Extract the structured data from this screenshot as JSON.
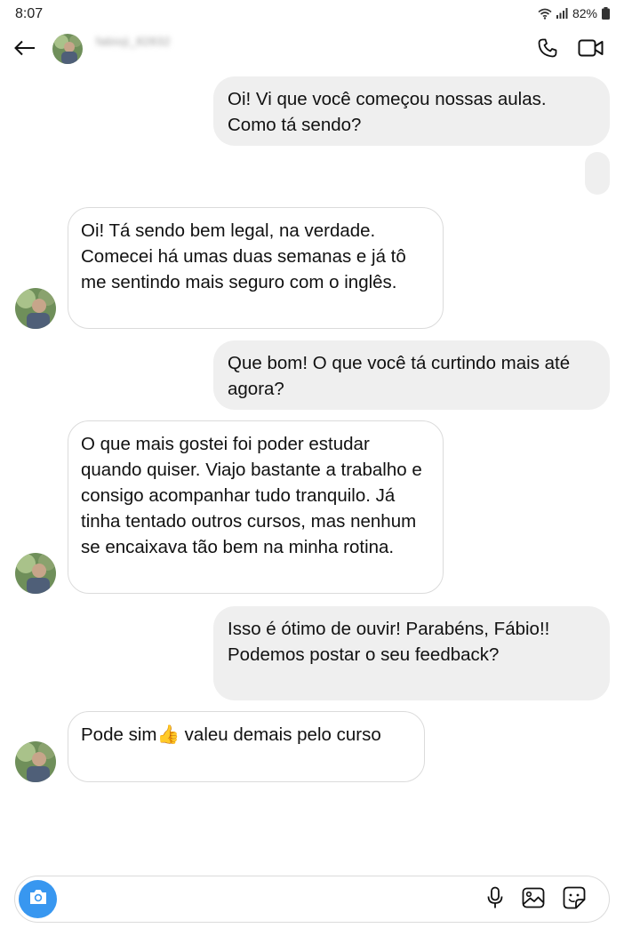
{
  "status_bar": {
    "time": "8:07",
    "battery": "82%"
  },
  "header": {
    "contact_name": "fabioji_82832"
  },
  "messages": [
    {
      "side": "out",
      "text": "Oi! Vi que você começou nossas aulas. Como tá sendo?"
    },
    {
      "side": "out",
      "text": ""
    },
    {
      "side": "in",
      "text": "Oi! Tá sendo bem legal, na verdade. Comecei há umas duas semanas e já tô me sentindo mais seguro com o inglês."
    },
    {
      "side": "out",
      "text": "Que bom! O que você tá curtindo mais até agora?"
    },
    {
      "side": "in",
      "text": "O que mais gostei foi poder estudar quando quiser. Viajo bastante a trabalho e consigo acompanhar tudo tranquilo. Já tinha tentado outros cursos, mas nenhum se encaixava tão bem na minha rotina."
    },
    {
      "side": "out",
      "text": "Isso é ótimo de ouvir! Parabéns, Fábio!! Podemos postar o seu feedback?"
    },
    {
      "side": "in",
      "text": "Pode sim👍 valeu demais pelo curso"
    }
  ],
  "composer": {
    "placeholder": "",
    "value": ""
  },
  "icons": {
    "back": "arrow-left-icon",
    "call": "phone-icon",
    "video": "video-camera-icon",
    "camera": "camera-icon",
    "mic": "microphone-icon",
    "gallery": "image-icon",
    "sticker": "sticker-icon"
  },
  "colors": {
    "accent": "#3897f0",
    "outgoing_bubble": "#efefef",
    "incoming_border": "#dbdbdb"
  }
}
